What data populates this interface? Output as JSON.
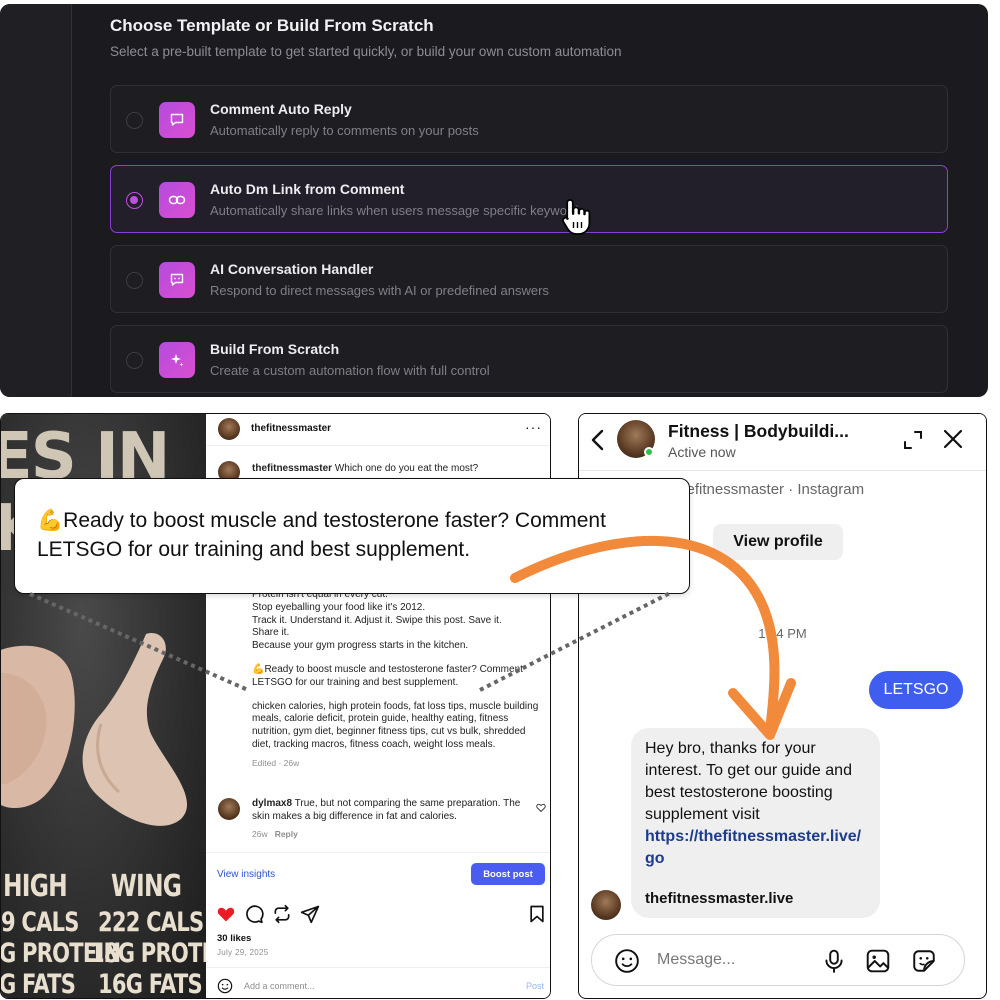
{
  "template_panel": {
    "heading": "Choose Template or Build From Scratch",
    "subheading": "Select a pre-built template to get started quickly, or build your own custom automation",
    "options": [
      {
        "title": "Comment Auto Reply",
        "description": "Automatically reply to comments on your posts",
        "icon": "chat-bubble-icon",
        "selected": false
      },
      {
        "title": "Auto Dm Link from Comment",
        "description": "Automatically share links when users message specific keywords",
        "icon": "link-icon",
        "selected": true
      },
      {
        "title": "AI Conversation Handler",
        "description": "Respond to direct messages with AI or predefined answers",
        "icon": "bot-message-icon",
        "selected": false
      },
      {
        "title": "Build From Scratch",
        "description": "Create a custom automation flow with full control",
        "icon": "sparkle-icon",
        "selected": false
      }
    ],
    "accent_color": "#c04fe0"
  },
  "post": {
    "image_text": {
      "headline": "ES IN",
      "headline2": "K",
      "col1": [
        "HIGH",
        "9 CALS",
        "G PROTEIN",
        "G FATS"
      ],
      "col2": [
        "WING",
        "222 CALS",
        "18G PROTEIN",
        "16G FATS"
      ]
    },
    "username": "thefitnessmaster",
    "caption_intro": "Which one do you eat the most?",
    "caption_lines": [
      "Protein isn't equal in every cut.",
      "Stop eyeballing your food like it's 2012.",
      "Track it. Understand it. Adjust it. Swipe this post. Save it.",
      "Share it.",
      "Because your gym progress starts in the kitchen."
    ],
    "caption_cta": "💪Ready to boost muscle and testosterone faster? Comment LETSGO for our training and best supplement.",
    "hashtags": "chicken calories, high protein foods, fat loss tips, muscle building meals, calorie deficit, protein guide, healthy eating, fitness nutrition, gym diet, beginner fitness tips, cut vs bulk, shredded diet, tracking macros, fitness coach, weight loss meals.",
    "edited": "Edited · 26w",
    "comment": {
      "user": "dylmax8",
      "text": "True, but not comparing the same preparation. The skin makes a big difference in fat and calories.",
      "age": "26w",
      "reply": "Reply"
    },
    "view_insights": "View insights",
    "boost_label": "Boost post",
    "likes": "30 likes",
    "date": "July 29, 2025",
    "add_comment_placeholder": "Add a comment...",
    "post_label": "Post"
  },
  "callout": {
    "text": "💪Ready to boost muscle and testosterone faster? Comment LETSGO for our training and best supplement."
  },
  "dm": {
    "name": "Fitness | Bodybuildi...",
    "status": "Active now",
    "handle": "thefitnessmaster · Instagram",
    "view_profile": "View profile",
    "time": "1:04 PM",
    "outgoing": "LETSGO",
    "incoming": "Hey bro, thanks for your interest. To get our guide and best testosterone boosting supplement visit",
    "link": "https://thefitnessmaster.live/go",
    "domain": "thefitnessmaster.live",
    "message_placeholder": "Message..."
  }
}
